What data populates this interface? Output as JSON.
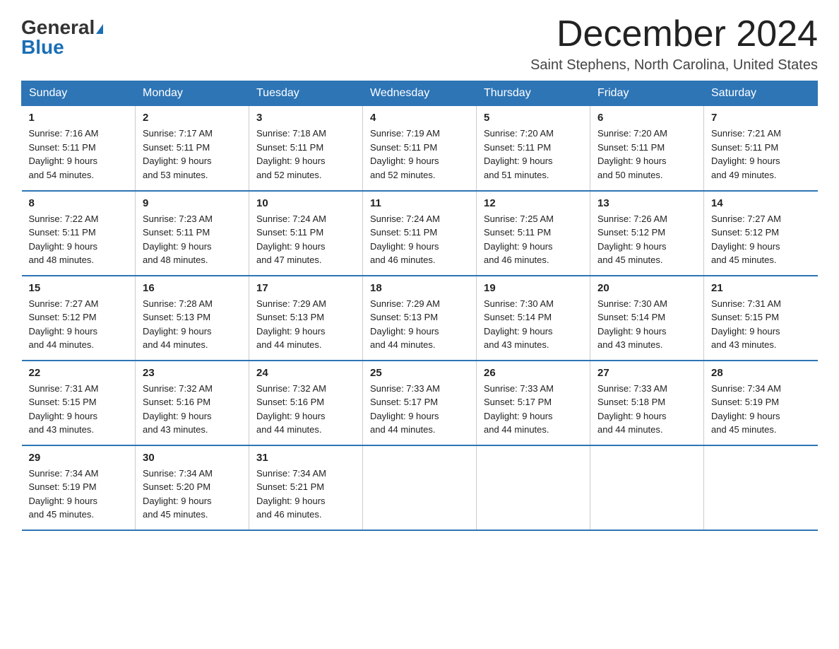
{
  "header": {
    "logo": {
      "general": "General",
      "blue": "Blue",
      "triangle_label": "logo-triangle"
    },
    "title": "December 2024",
    "location": "Saint Stephens, North Carolina, United States"
  },
  "calendar": {
    "days_of_week": [
      "Sunday",
      "Monday",
      "Tuesday",
      "Wednesday",
      "Thursday",
      "Friday",
      "Saturday"
    ],
    "weeks": [
      [
        {
          "day": "1",
          "sunrise": "7:16 AM",
          "sunset": "5:11 PM",
          "daylight": "9 hours and 54 minutes."
        },
        {
          "day": "2",
          "sunrise": "7:17 AM",
          "sunset": "5:11 PM",
          "daylight": "9 hours and 53 minutes."
        },
        {
          "day": "3",
          "sunrise": "7:18 AM",
          "sunset": "5:11 PM",
          "daylight": "9 hours and 52 minutes."
        },
        {
          "day": "4",
          "sunrise": "7:19 AM",
          "sunset": "5:11 PM",
          "daylight": "9 hours and 52 minutes."
        },
        {
          "day": "5",
          "sunrise": "7:20 AM",
          "sunset": "5:11 PM",
          "daylight": "9 hours and 51 minutes."
        },
        {
          "day": "6",
          "sunrise": "7:20 AM",
          "sunset": "5:11 PM",
          "daylight": "9 hours and 50 minutes."
        },
        {
          "day": "7",
          "sunrise": "7:21 AM",
          "sunset": "5:11 PM",
          "daylight": "9 hours and 49 minutes."
        }
      ],
      [
        {
          "day": "8",
          "sunrise": "7:22 AM",
          "sunset": "5:11 PM",
          "daylight": "9 hours and 48 minutes."
        },
        {
          "day": "9",
          "sunrise": "7:23 AM",
          "sunset": "5:11 PM",
          "daylight": "9 hours and 48 minutes."
        },
        {
          "day": "10",
          "sunrise": "7:24 AM",
          "sunset": "5:11 PM",
          "daylight": "9 hours and 47 minutes."
        },
        {
          "day": "11",
          "sunrise": "7:24 AM",
          "sunset": "5:11 PM",
          "daylight": "9 hours and 46 minutes."
        },
        {
          "day": "12",
          "sunrise": "7:25 AM",
          "sunset": "5:11 PM",
          "daylight": "9 hours and 46 minutes."
        },
        {
          "day": "13",
          "sunrise": "7:26 AM",
          "sunset": "5:12 PM",
          "daylight": "9 hours and 45 minutes."
        },
        {
          "day": "14",
          "sunrise": "7:27 AM",
          "sunset": "5:12 PM",
          "daylight": "9 hours and 45 minutes."
        }
      ],
      [
        {
          "day": "15",
          "sunrise": "7:27 AM",
          "sunset": "5:12 PM",
          "daylight": "9 hours and 44 minutes."
        },
        {
          "day": "16",
          "sunrise": "7:28 AM",
          "sunset": "5:13 PM",
          "daylight": "9 hours and 44 minutes."
        },
        {
          "day": "17",
          "sunrise": "7:29 AM",
          "sunset": "5:13 PM",
          "daylight": "9 hours and 44 minutes."
        },
        {
          "day": "18",
          "sunrise": "7:29 AM",
          "sunset": "5:13 PM",
          "daylight": "9 hours and 44 minutes."
        },
        {
          "day": "19",
          "sunrise": "7:30 AM",
          "sunset": "5:14 PM",
          "daylight": "9 hours and 43 minutes."
        },
        {
          "day": "20",
          "sunrise": "7:30 AM",
          "sunset": "5:14 PM",
          "daylight": "9 hours and 43 minutes."
        },
        {
          "day": "21",
          "sunrise": "7:31 AM",
          "sunset": "5:15 PM",
          "daylight": "9 hours and 43 minutes."
        }
      ],
      [
        {
          "day": "22",
          "sunrise": "7:31 AM",
          "sunset": "5:15 PM",
          "daylight": "9 hours and 43 minutes."
        },
        {
          "day": "23",
          "sunrise": "7:32 AM",
          "sunset": "5:16 PM",
          "daylight": "9 hours and 43 minutes."
        },
        {
          "day": "24",
          "sunrise": "7:32 AM",
          "sunset": "5:16 PM",
          "daylight": "9 hours and 44 minutes."
        },
        {
          "day": "25",
          "sunrise": "7:33 AM",
          "sunset": "5:17 PM",
          "daylight": "9 hours and 44 minutes."
        },
        {
          "day": "26",
          "sunrise": "7:33 AM",
          "sunset": "5:17 PM",
          "daylight": "9 hours and 44 minutes."
        },
        {
          "day": "27",
          "sunrise": "7:33 AM",
          "sunset": "5:18 PM",
          "daylight": "9 hours and 44 minutes."
        },
        {
          "day": "28",
          "sunrise": "7:34 AM",
          "sunset": "5:19 PM",
          "daylight": "9 hours and 45 minutes."
        }
      ],
      [
        {
          "day": "29",
          "sunrise": "7:34 AM",
          "sunset": "5:19 PM",
          "daylight": "9 hours and 45 minutes."
        },
        {
          "day": "30",
          "sunrise": "7:34 AM",
          "sunset": "5:20 PM",
          "daylight": "9 hours and 45 minutes."
        },
        {
          "day": "31",
          "sunrise": "7:34 AM",
          "sunset": "5:21 PM",
          "daylight": "9 hours and 46 minutes."
        },
        {
          "day": "",
          "sunrise": "",
          "sunset": "",
          "daylight": ""
        },
        {
          "day": "",
          "sunrise": "",
          "sunset": "",
          "daylight": ""
        },
        {
          "day": "",
          "sunrise": "",
          "sunset": "",
          "daylight": ""
        },
        {
          "day": "",
          "sunrise": "",
          "sunset": "",
          "daylight": ""
        }
      ]
    ]
  },
  "labels": {
    "sunrise": "Sunrise:",
    "sunset": "Sunset:",
    "daylight": "Daylight:"
  }
}
